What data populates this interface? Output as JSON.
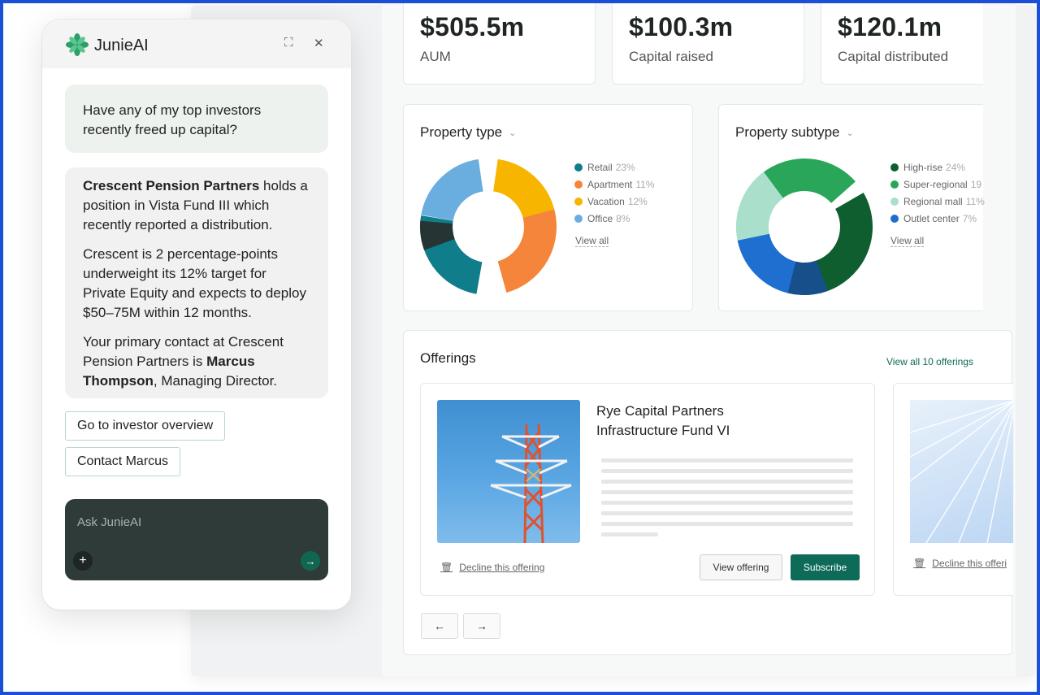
{
  "stats": [
    {
      "value": "$505.5m",
      "label": "AUM"
    },
    {
      "value": "$100.3m",
      "label": "Capital raised"
    },
    {
      "value": "$120.1m",
      "label": "Capital distributed"
    }
  ],
  "property_type": {
    "title": "Property type",
    "legend": [
      {
        "name": "Retail",
        "pct": "23%",
        "color": "#0f7d8a"
      },
      {
        "name": "Apartment",
        "pct": "11%",
        "color": "#f5853a"
      },
      {
        "name": "Vacation",
        "pct": "12%",
        "color": "#f7b500"
      },
      {
        "name": "Office",
        "pct": "8%",
        "color": "#6aaee0"
      }
    ],
    "view_all": "View all"
  },
  "property_subtype": {
    "title": "Property subtype",
    "legend": [
      {
        "name": "High-rise",
        "pct": "24%",
        "color": "#0e5e30"
      },
      {
        "name": "Super-regional",
        "pct": "19",
        "color": "#2aa65a"
      },
      {
        "name": "Regional mall",
        "pct": "11%",
        "color": "#aadfcc"
      },
      {
        "name": "Outlet center",
        "pct": "7%",
        "color": "#1e6fd0"
      }
    ],
    "view_all": "View all"
  },
  "chart_data": [
    {
      "type": "pie",
      "title": "Property type",
      "categories": [
        "Retail",
        "Apartment",
        "Vacation",
        "Office"
      ],
      "values": [
        23,
        11,
        12,
        8
      ]
    },
    {
      "type": "pie",
      "title": "Property subtype",
      "categories": [
        "High-rise",
        "Super-regional",
        "Regional mall",
        "Outlet center"
      ],
      "values": [
        24,
        19,
        11,
        7
      ]
    }
  ],
  "offerings": {
    "title": "Offerings",
    "view_all": "View all 10 offerings",
    "card": {
      "title_line1": "Rye Capital Partners",
      "title_line2": "Infrastructure Fund VI",
      "decline": "Decline this offering",
      "view": "View offering",
      "subscribe": "Subscribe"
    },
    "card2_decline": "Decline this offeri"
  },
  "nav": {
    "prev": "←",
    "next": "→"
  },
  "chat": {
    "title": "JunieAI",
    "question": "Have any of my top investors recently freed up capital?",
    "answer_p1_bold": "Crescent Pension Partners",
    "answer_p1_rest": " holds a position in Vista Fund III which recently reported a distribution.",
    "answer_p2": "Crescent is 2 percentage-points underweight its 12% target for Private Equity and expects to deploy $50–75M within 12 months.",
    "answer_p3_pre": "Your primary contact at Crescent Pension Partners is ",
    "answer_p3_bold": "Marcus Thompson",
    "answer_p3_post": ", Managing Director.",
    "chip1": "Go to investor overview",
    "chip2": "Contact Marcus",
    "placeholder": "Ask JunieAI",
    "plus": "+",
    "send": "→",
    "expand_icon": "⛶",
    "close_icon": "✕"
  }
}
